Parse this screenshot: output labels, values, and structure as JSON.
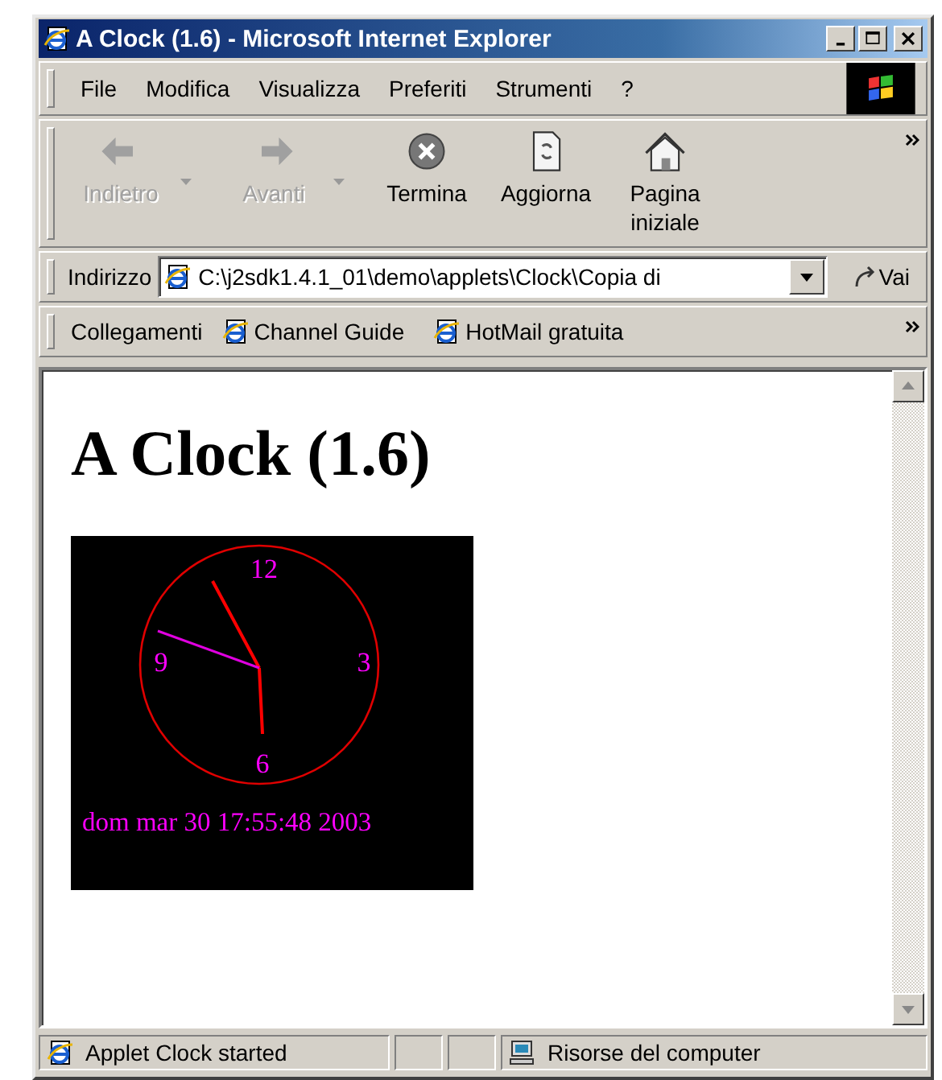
{
  "window": {
    "title": "A Clock (1.6) - Microsoft Internet Explorer"
  },
  "menu": [
    {
      "label": "File"
    },
    {
      "label": "Modifica"
    },
    {
      "label": "Visualizza"
    },
    {
      "label": "Preferiti"
    },
    {
      "label": "Strumenti"
    },
    {
      "label": "?"
    }
  ],
  "toolbar": [
    {
      "kind": "back",
      "label": "Indietro",
      "disabled": true,
      "dropdown": true
    },
    {
      "kind": "forward",
      "label": "Avanti",
      "disabled": true,
      "dropdown": true
    },
    {
      "kind": "stop",
      "label": "Termina",
      "disabled": false,
      "dropdown": false
    },
    {
      "kind": "refresh",
      "label": "Aggiorna",
      "disabled": false,
      "dropdown": false
    },
    {
      "kind": "home",
      "label": "Pagina iniziale",
      "disabled": false,
      "dropdown": false
    }
  ],
  "address_bar": {
    "label": "Indirizzo",
    "value": "C:\\j2sdk1.4.1_01\\demo\\applets\\Clock\\Copia di",
    "go": "Vai"
  },
  "links_bar": {
    "label": "Collegamenti",
    "links": [
      {
        "label": "Channel Guide"
      },
      {
        "label": "HotMail gratuita"
      }
    ]
  },
  "page": {
    "heading": "A Clock (1.6)",
    "applet": {
      "numerals": [
        "12",
        "3",
        "6",
        "9"
      ],
      "date": "dom mar 30 17:55:48 2003"
    }
  },
  "status_bar": {
    "message": "Applet Clock started",
    "zone": "Risorse del computer"
  }
}
